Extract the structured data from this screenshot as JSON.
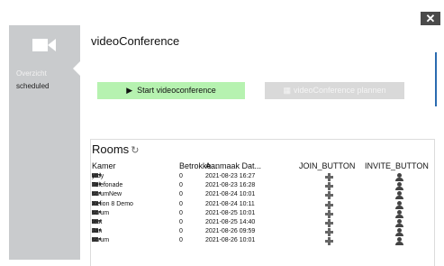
{
  "window": {
    "close_label": "✕"
  },
  "sidebar": {
    "items": [
      {
        "label": "Overzicht"
      },
      {
        "label": "scheduled"
      }
    ]
  },
  "main": {
    "title": "videoConference",
    "start_button": "Start videoconference",
    "plan_button": "videoConference plannen"
  },
  "rooms": {
    "title": "Rooms",
    "columns": [
      "Kamer",
      "Betrokke...",
      "Aanmaak Dat...",
      "JOIN_BUTTON",
      "INVITE_BUTTON"
    ],
    "rows": [
      {
        "name": "yrdy",
        "count": "0",
        "date": "2021-08-23 16:27"
      },
      {
        "name": "Telefonade",
        "count": "0",
        "date": "2021-08-23 16:28"
      },
      {
        "name": "scrumNew",
        "count": "0",
        "date": "2021-08-24 10:01"
      },
      {
        "name": "Xelion 8 Demo",
        "count": "0",
        "date": "2021-08-24 10:11"
      },
      {
        "name": "scrum",
        "count": "0",
        "date": "2021-08-25 10:01"
      },
      {
        "name": "test",
        "count": "0",
        "date": "2021-08-25 14:40"
      },
      {
        "name": "Jan",
        "count": "0",
        "date": "2021-08-26 09:59"
      },
      {
        "name": "scrum",
        "count": "0",
        "date": "2021-08-26 10:01"
      }
    ]
  }
}
